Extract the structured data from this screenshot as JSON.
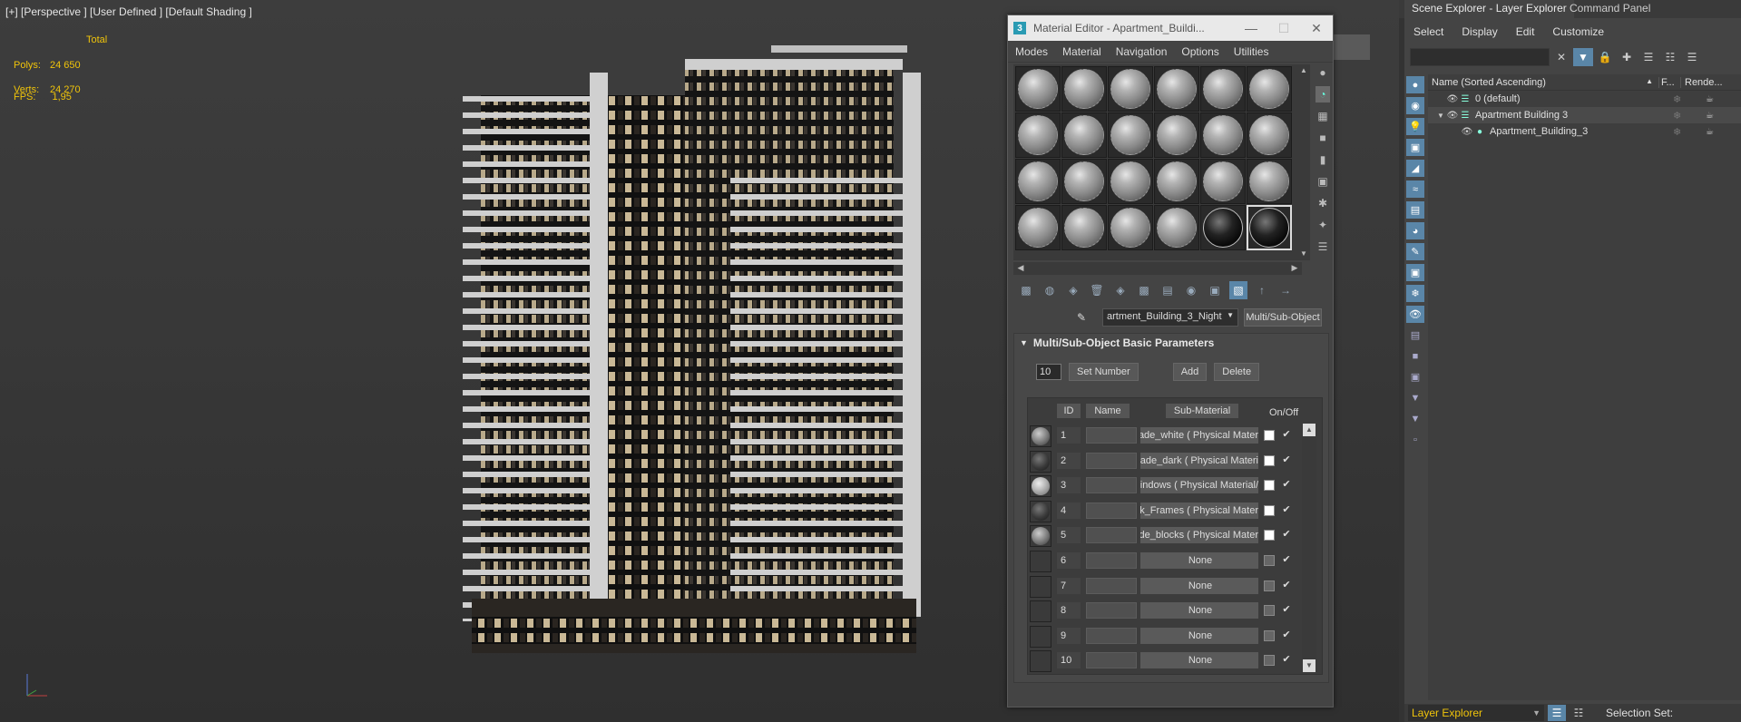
{
  "viewport": {
    "label": "[+] [Perspective ] [User Defined ] [Default Shading ]",
    "stats_header": "Total",
    "polys_label": "Polys:",
    "polys_value": "24 650",
    "verts_label": "Verts:",
    "verts_value": "24 270",
    "fps_label": "FPS:",
    "fps_value": "1,95"
  },
  "material_editor": {
    "title": "Material Editor - Apartment_Buildi...",
    "app_icon": "3",
    "menu": [
      "Modes",
      "Material",
      "Navigation",
      "Options",
      "Utilities"
    ],
    "material_name": "artment_Building_3_Night",
    "material_type": "Multi/Sub-Object",
    "rollout_title": "Multi/Sub-Object Basic Parameters",
    "set_number_value": "10",
    "set_number_label": "Set Number",
    "add_label": "Add",
    "delete_label": "Delete",
    "col_id": "ID",
    "col_name": "Name",
    "col_sub": "Sub-Material",
    "col_onoff": "On/Off",
    "rows": [
      {
        "id": "1",
        "sub": "ade_white  ( Physical Mater",
        "type": "light",
        "color": "on"
      },
      {
        "id": "2",
        "sub": "ade_dark  ( Physical Materi",
        "type": "dark",
        "color": "on"
      },
      {
        "id": "3",
        "sub": "/indows  ( Physical Material",
        "type": "win",
        "color": "on"
      },
      {
        "id": "4",
        "sub": "k_Frames  ( Physical Mater",
        "type": "dark",
        "color": "on"
      },
      {
        "id": "5",
        "sub": "ade_blocks  ( Physical Mater",
        "type": "light",
        "color": "on"
      },
      {
        "id": "6",
        "sub": "None",
        "type": "empty",
        "color": "off"
      },
      {
        "id": "7",
        "sub": "None",
        "type": "empty",
        "color": "off"
      },
      {
        "id": "8",
        "sub": "None",
        "type": "empty",
        "color": "off"
      },
      {
        "id": "9",
        "sub": "None",
        "type": "empty",
        "color": "off"
      },
      {
        "id": "10",
        "sub": "None",
        "type": "empty",
        "color": "off"
      }
    ]
  },
  "side_panel": {
    "tabs": [
      "Scene Explorer - Layer Explorer",
      "Command Panel"
    ],
    "menu": [
      "Select",
      "Display",
      "Edit",
      "Customize"
    ],
    "col_name": "Name (Sorted Ascending)",
    "col_freeze": "F...",
    "col_render": "Rende...",
    "tree": [
      {
        "label": "0 (default)",
        "level": 0,
        "expand": "",
        "selected": false
      },
      {
        "label": "Apartment Building 3",
        "level": 0,
        "expand": "▼",
        "selected": true
      },
      {
        "label": "Apartment_Building_3",
        "level": 1,
        "expand": "",
        "selected": false
      }
    ],
    "bottom_combo": "Layer Explorer",
    "selection_set": "Selection Set:"
  }
}
